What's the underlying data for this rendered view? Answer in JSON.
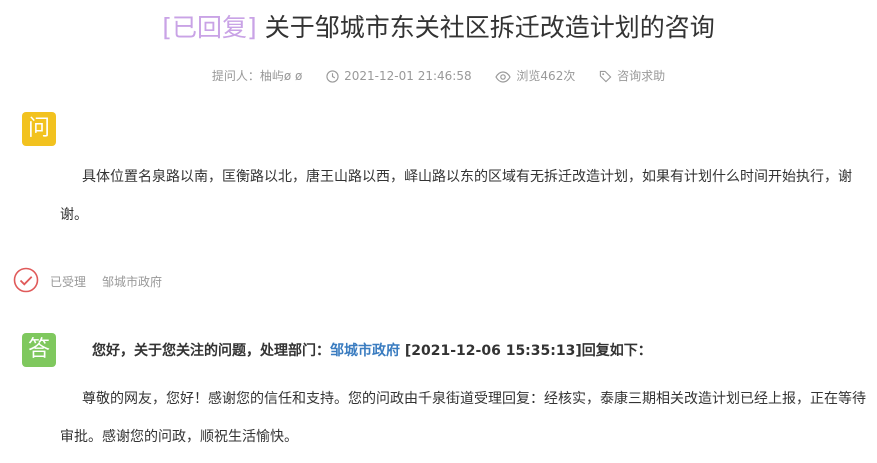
{
  "title": {
    "status": "[已回复]",
    "text": "关于邹城市东关社区拆迁改造计划的咨询"
  },
  "meta": {
    "asker": "提问人：柚屿ø ø",
    "time": "2021-12-01 21:46:58",
    "views": "浏览462次",
    "category": "咨询求助"
  },
  "question": {
    "badge": "问",
    "text": "具体位置名泉路以南，匡衡路以北，唐王山路以西，峄山路以东的区域有无拆迁改造计划，如果有计划什么时间开始执行，谢谢。"
  },
  "status": {
    "label": "已受理",
    "department": "邹城市政府"
  },
  "answer": {
    "badge": "答",
    "head_prefix": "您好，关于您关注的问题，处理部门：",
    "head_department": "邹城市政府",
    "head_suffix": " [2021-12-06 15:35:13]回复如下：",
    "text": "尊敬的网友，您好！感谢您的信任和支持。您的问政由千泉街道受理回复：经核实，泰康三期相关改造计划已经上报，正在等待审批。感谢您的问政，顺祝生活愉快。"
  },
  "colors": {
    "status": "#c9a3e6",
    "question_badge": "#f2c21f",
    "answer_badge": "#7fc85e",
    "accepted_icon": "#e05a5a",
    "department_link": "#3a7cc0"
  }
}
